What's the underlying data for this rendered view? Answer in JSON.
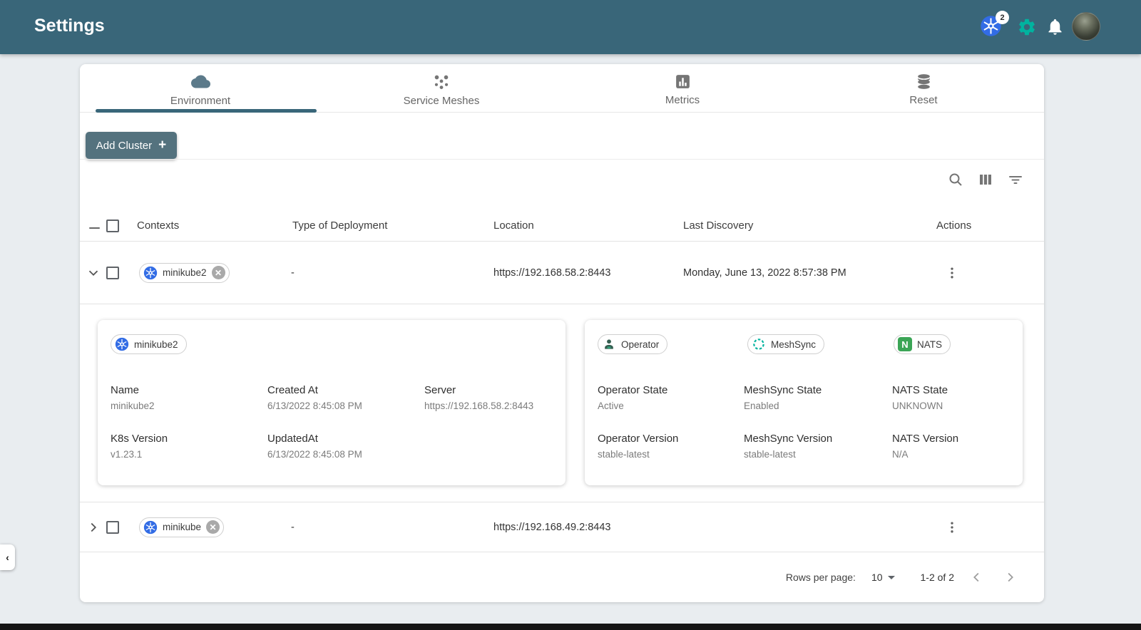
{
  "header": {
    "title": "Settings",
    "kubernetes_badge": "2",
    "icons": [
      "kubernetes-icon",
      "settings-gear-icon",
      "notifications-bell-icon",
      "user-avatar"
    ]
  },
  "tabs": [
    {
      "label": "Environment",
      "icon": "cloud-icon",
      "active": true
    },
    {
      "label": "Service Meshes",
      "icon": "mesh-dots-icon",
      "active": false
    },
    {
      "label": "Metrics",
      "icon": "bar-chart-icon",
      "active": false
    },
    {
      "label": "Reset",
      "icon": "database-icon",
      "active": false
    }
  ],
  "add_cluster": {
    "label": "Add Cluster",
    "plus": "+"
  },
  "table_toolbar": {
    "icons": [
      "search-icon",
      "view-columns-icon",
      "filter-icon"
    ]
  },
  "table": {
    "columns": [
      "Contexts",
      "Type of Deployment",
      "Location",
      "Last Discovery",
      "Actions"
    ],
    "rows": [
      {
        "context": "minikube2",
        "type_of_deployment": "-",
        "location": "https://192.168.58.2:8443",
        "last_discovery": "Monday, June 13, 2022 8:57:38 PM",
        "expanded": true
      },
      {
        "context": "minikube",
        "type_of_deployment": "-",
        "location": "https://192.168.49.2:8443",
        "last_discovery": "",
        "expanded": false
      }
    ]
  },
  "detail": {
    "cluster_card": {
      "chip": "minikube2",
      "fields": [
        {
          "label": "Name",
          "value": "minikube2"
        },
        {
          "label": "Created At",
          "value": "6/13/2022 8:45:08 PM"
        },
        {
          "label": "Server",
          "value": "https://192.168.58.2:8443"
        },
        {
          "label": "K8s Version",
          "value": "v1.23.1"
        },
        {
          "label": "UpdatedAt",
          "value": "6/13/2022 8:45:08 PM"
        }
      ]
    },
    "operator_card": {
      "chips": [
        "Operator",
        "MeshSync",
        "NATS"
      ],
      "chip_icons": [
        "operator-person-icon",
        "meshsync-dashed-circle-icon",
        "nats-logo-icon"
      ],
      "fields": [
        {
          "label": "Operator State",
          "value": "Active"
        },
        {
          "label": "MeshSync State",
          "value": "Enabled"
        },
        {
          "label": "NATS State",
          "value": "UNKNOWN"
        },
        {
          "label": "Operator Version",
          "value": "stable-latest"
        },
        {
          "label": "MeshSync Version",
          "value": "stable-latest"
        },
        {
          "label": "NATS Version",
          "value": "N/A"
        }
      ]
    }
  },
  "pagination": {
    "label": "Rows per page:",
    "value": "10",
    "range": "1-2 of 2"
  },
  "colors": {
    "header_bg": "#396679",
    "accent_teal": "#396679",
    "button_bg": "#54727E",
    "gear_green": "#00B39F",
    "kubernetes_blue": "#326CE5",
    "meshsync_green": "#00B39F",
    "nats_green": "#3BA556",
    "page_bg": "#E9EDF0"
  }
}
